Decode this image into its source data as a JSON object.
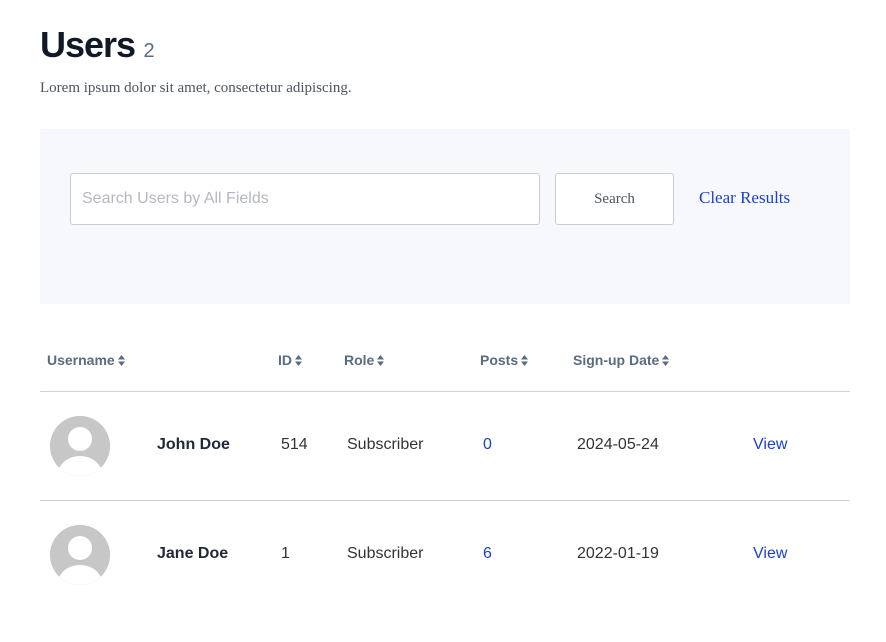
{
  "header": {
    "title": "Users",
    "count": "2",
    "subtitle": "Lorem ipsum dolor sit amet, consectetur adipiscing."
  },
  "search": {
    "placeholder": "Search Users by All Fields",
    "value": "",
    "button_label": "Search",
    "clear_label": "Clear Results"
  },
  "table": {
    "columns": {
      "username": "Username",
      "id": "ID",
      "role": "Role",
      "posts": "Posts",
      "signup": "Sign-up Date"
    },
    "rows": [
      {
        "username": "John Doe",
        "id": "514",
        "role": "Subscriber",
        "posts": "0",
        "signup": "2024-05-24",
        "action": "View"
      },
      {
        "username": "Jane Doe",
        "id": "1",
        "role": "Subscriber",
        "posts": "6",
        "signup": "2022-01-19",
        "action": "View"
      }
    ]
  },
  "icons": {
    "sort": "sort-icon",
    "avatar": "user-avatar-icon"
  },
  "colors": {
    "link": "#1a3fd6",
    "panel_bg": "#f7f8fc",
    "header_text": "#5b6b80",
    "avatar_bg": "#c7c7c7"
  }
}
